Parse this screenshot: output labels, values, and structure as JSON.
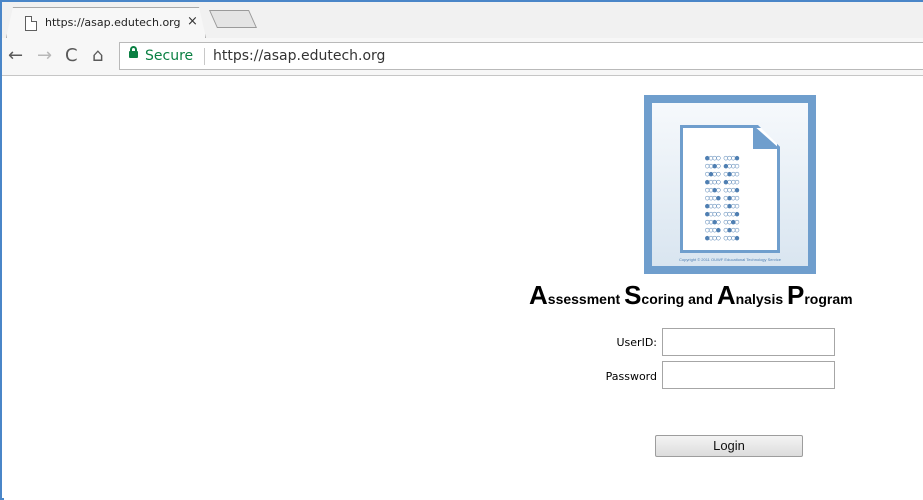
{
  "browser": {
    "tab": {
      "title": "https://asap.edutech.org",
      "close_glyph": "×",
      "icon": "page-icon"
    },
    "nav": {
      "back_glyph": "←",
      "forward_glyph": "→",
      "reload_glyph": "C",
      "home_glyph": "⌂"
    },
    "omnibox": {
      "secure_label": "Secure",
      "url": "https://asap.edutech.org",
      "lock_color": "#0b8043"
    }
  },
  "logo": {
    "icon": "answer-sheet-icon",
    "bubble_rows": [
      "●○○○ ○○○●",
      "○○●○ ●○○○",
      "○●○○ ○●○○",
      "●○○○ ●○○○",
      "○○●○ ○○○●",
      "○○○● ○●○○",
      "●○○○ ○●○○",
      "●○○○ ○○○●",
      "○○●○ ○○●○",
      "○○○● ○●○○",
      "●○○○ ○○○●"
    ],
    "copyright": "Copyright © 2011 OUWF Educational Technology Service",
    "color": "#6f9ecd"
  },
  "title": {
    "words": [
      {
        "initial": "A",
        "rest": "ssessment "
      },
      {
        "initial": "S",
        "rest": "coring and "
      },
      {
        "initial": "A",
        "rest": "nalysis "
      },
      {
        "initial": "P",
        "rest": "rogram"
      }
    ]
  },
  "form": {
    "userid_label": "UserID:",
    "password_label": "Password",
    "userid_value": "",
    "password_value": "",
    "login_label": "Login"
  }
}
